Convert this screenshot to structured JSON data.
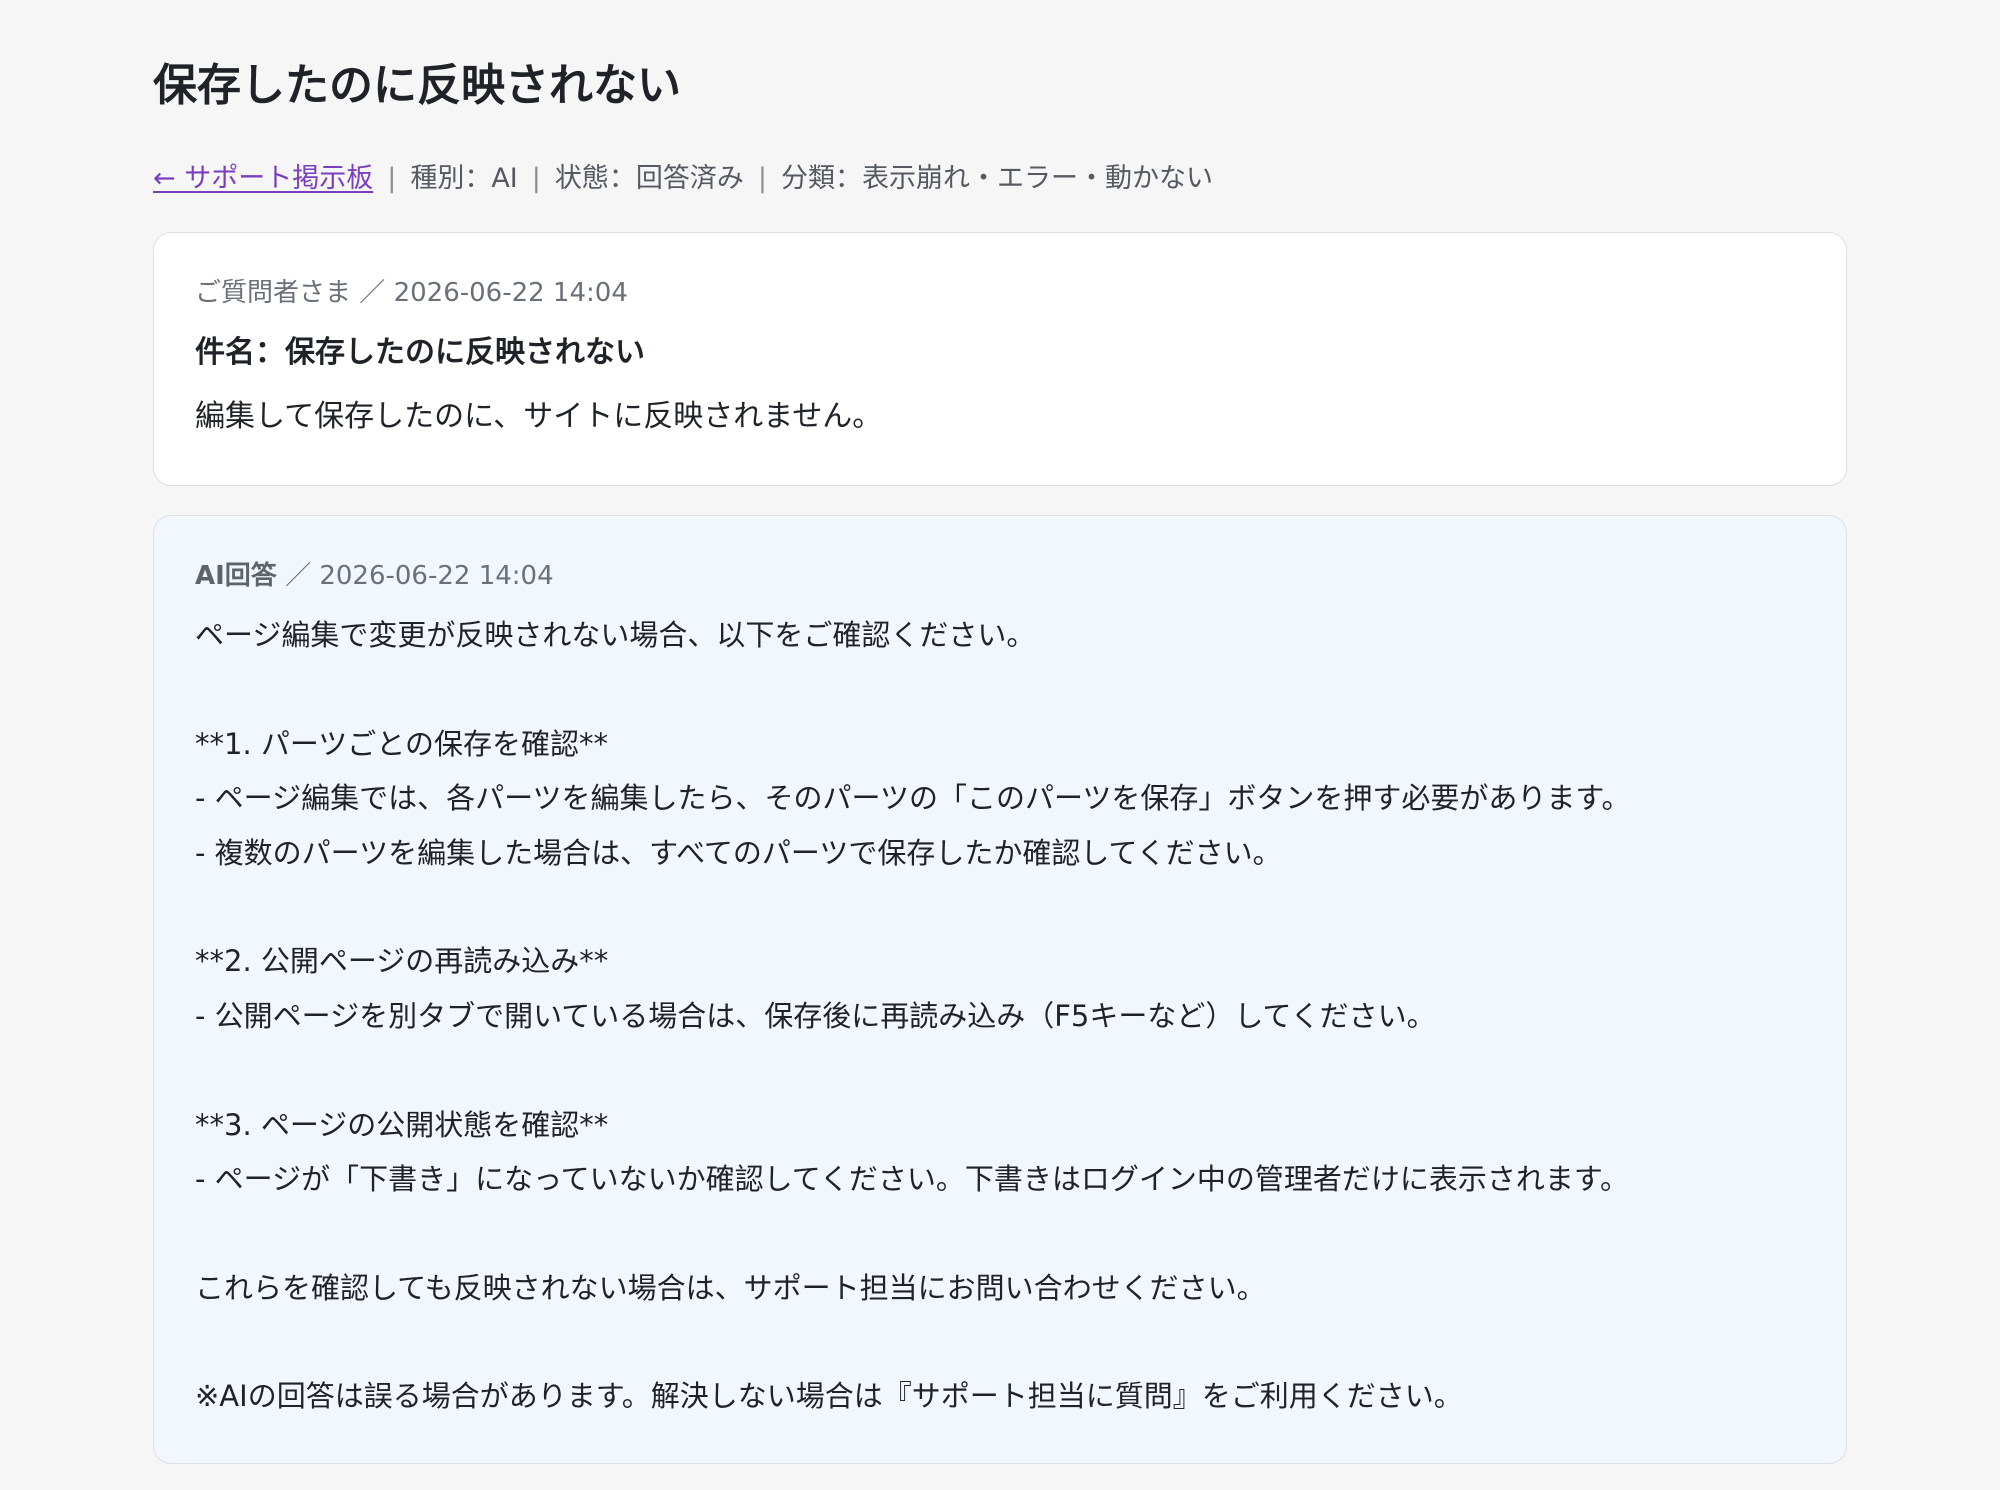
{
  "page": {
    "title": "保存したのに反映されない"
  },
  "meta_bar": {
    "back_link": "← サポート掲示板",
    "separator": "|",
    "type": "種別：AI",
    "status": "状態：回答済み",
    "category": "分類：表示崩れ・エラー・動かない"
  },
  "question": {
    "author": "ご質問者さま",
    "slash": "／",
    "datetime": "2026-06-22 14:04",
    "subject": "件名：保存したのに反映されない",
    "body": "編集して保存したのに、サイトに反映されません。"
  },
  "answer": {
    "author": "AI回答",
    "slash": "／",
    "datetime": "2026-06-22 14:04",
    "lines": [
      "ページ編集で変更が反映されない場合、以下をご確認ください。",
      "",
      "**1. パーツごとの保存を確認**",
      "- ページ編集では、各パーツを編集したら、そのパーツの「このパーツを保存」ボタンを押す必要があります。",
      "- 複数のパーツを編集した場合は、すべてのパーツで保存したか確認してください。",
      "",
      "**2. 公開ページの再読み込み**",
      "- 公開ページを別タブで開いている場合は、保存後に再読み込み（F5キーなど）してください。",
      "",
      "**3. ページの公開状態を確認**",
      "- ページが「下書き」になっていないか確認してください。下書きはログイン中の管理者だけに表示されます。",
      "",
      "これらを確認しても反映されない場合は、サポート担当にお問い合わせください。",
      "",
      "※AIの回答は誤る場合があります。解決しない場合は『サポート担当に質問』をご利用ください。"
    ]
  },
  "colors": {
    "background": "#f6f6f7",
    "link": "#7a3fbf",
    "answer_card_bg": "#f2f6fd",
    "question_card_bg": "#ffffff",
    "border": "#dcdfe4"
  }
}
